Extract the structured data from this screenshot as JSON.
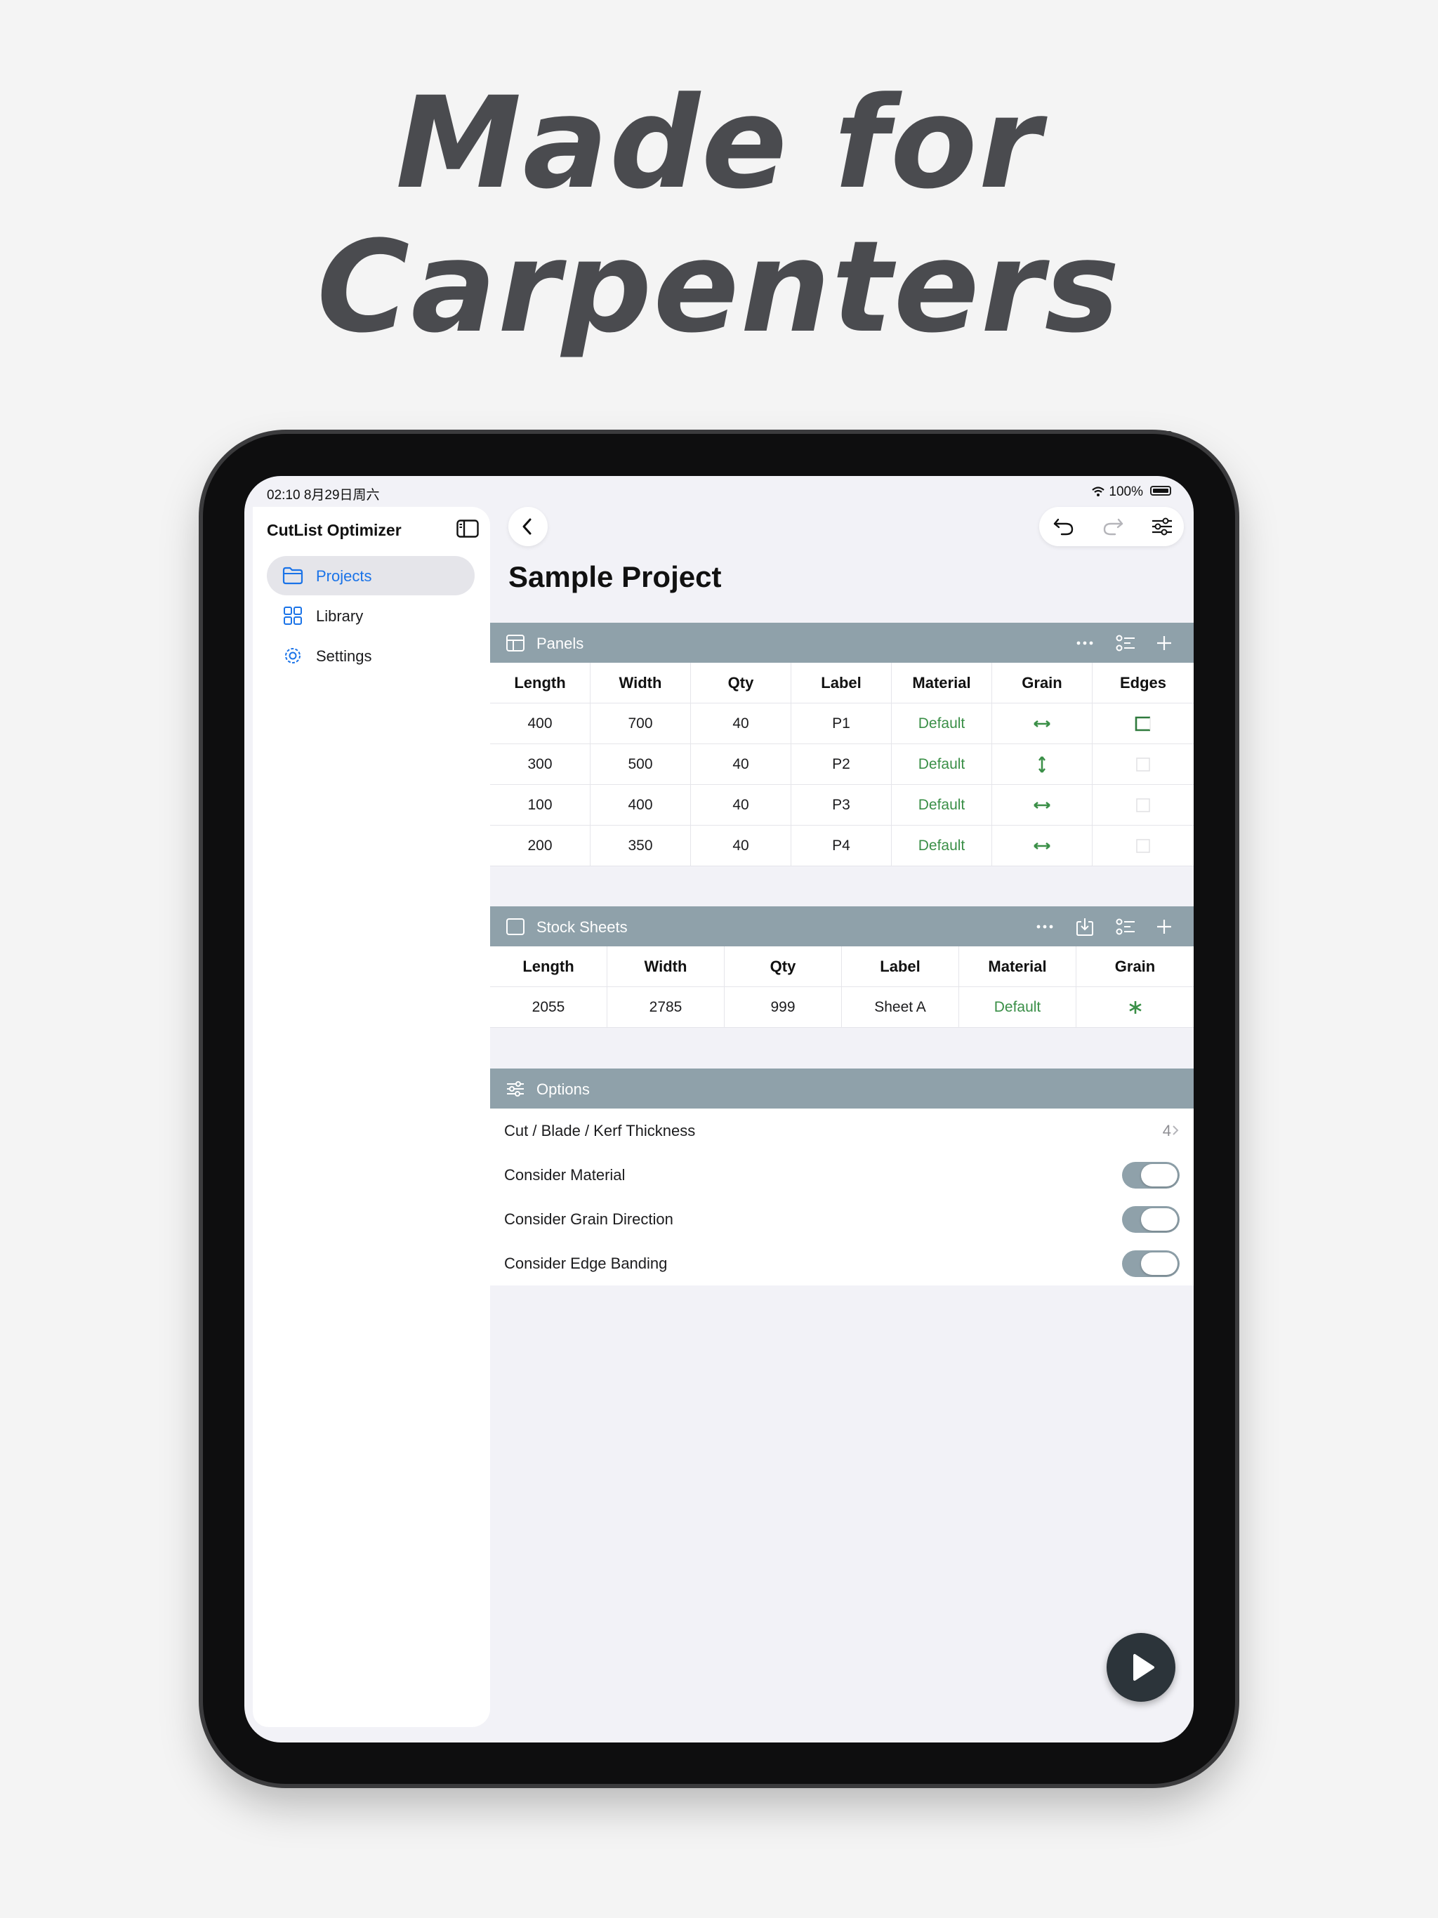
{
  "headline": {
    "line1": "Made for",
    "line2": "Carpenters"
  },
  "status_bar": {
    "time": "02:10  8月29日周六",
    "battery": "100%"
  },
  "sidebar": {
    "app_title": "CutList Optimizer",
    "items": [
      {
        "label": "Projects",
        "icon": "folder-icon",
        "active": true
      },
      {
        "label": "Library",
        "icon": "grid-icon",
        "active": false
      },
      {
        "label": "Settings",
        "icon": "gear-icon",
        "active": false
      }
    ]
  },
  "main": {
    "title": "Sample Project"
  },
  "panels": {
    "title": "Panels",
    "columns": [
      "Length",
      "Width",
      "Qty",
      "Label",
      "Material",
      "Grain",
      "Edges"
    ],
    "rows": [
      {
        "length": "400",
        "width": "700",
        "qty": "40",
        "label": "P1",
        "material": "Default",
        "grain": "horizontal",
        "edges": "bracket"
      },
      {
        "length": "300",
        "width": "500",
        "qty": "40",
        "label": "P2",
        "material": "Default",
        "grain": "vertical",
        "edges": "none"
      },
      {
        "length": "100",
        "width": "400",
        "qty": "40",
        "label": "P3",
        "material": "Default",
        "grain": "horizontal",
        "edges": "none"
      },
      {
        "length": "200",
        "width": "350",
        "qty": "40",
        "label": "P4",
        "material": "Default",
        "grain": "horizontal",
        "edges": "none"
      }
    ]
  },
  "stock_sheets": {
    "title": "Stock Sheets",
    "columns": [
      "Length",
      "Width",
      "Qty",
      "Label",
      "Material",
      "Grain"
    ],
    "rows": [
      {
        "length": "2055",
        "width": "2785",
        "qty": "999",
        "label": "Sheet A",
        "material": "Default",
        "grain": "any"
      }
    ]
  },
  "options": {
    "title": "Options",
    "kerf": {
      "label": "Cut / Blade / Kerf Thickness",
      "value": "4"
    },
    "toggles": [
      {
        "label": "Consider Material",
        "on": true
      },
      {
        "label": "Consider Grain Direction",
        "on": true
      },
      {
        "label": "Consider Edge Banding",
        "on": true
      }
    ]
  },
  "colors": {
    "accent": "#1a73e8",
    "section_header": "#8fa1aa",
    "material_green": "#3a8f47",
    "fab": "#2c343a"
  }
}
